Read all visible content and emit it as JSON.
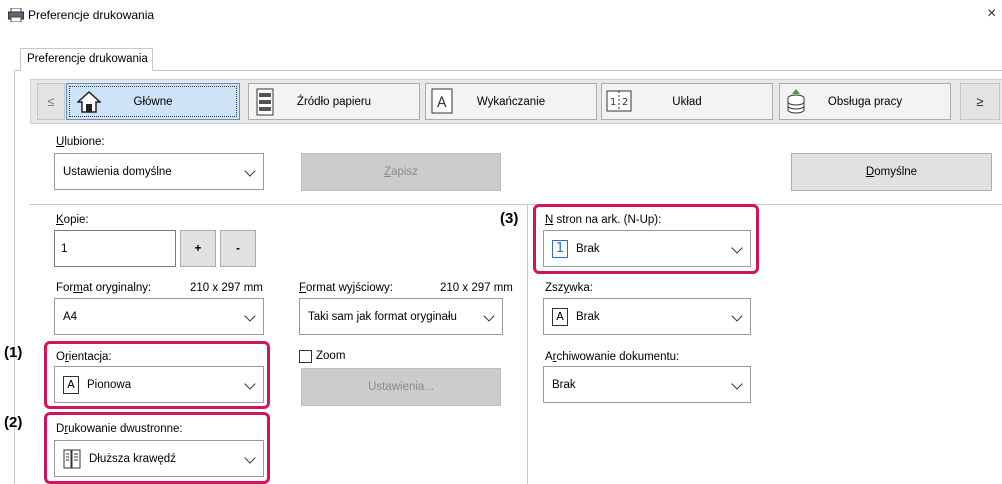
{
  "window": {
    "title": "Preferencje drukowania",
    "close_glyph": "×"
  },
  "tab": {
    "label": "Preferencje drukowania"
  },
  "toolbar": {
    "prev": "≤",
    "next": "≥",
    "buttons": [
      {
        "label": "Główne",
        "icon": "home-icon",
        "active": true
      },
      {
        "label": "Źródło papieru",
        "icon": "printer-tray-icon"
      },
      {
        "label": "Wykańczanie",
        "icon": "document-A-icon"
      },
      {
        "label": "Układ",
        "icon": "two-page-layout-icon"
      },
      {
        "label": "Obsługa pracy",
        "icon": "stack-icon"
      }
    ]
  },
  "favorites": {
    "label": "Ulubione:",
    "value": "Ustawienia domyślne",
    "save": "Zapisz",
    "defaults": "Domyślne"
  },
  "copies": {
    "label": "Kopie:",
    "value": "1",
    "plus": "+",
    "minus": "-"
  },
  "original_size": {
    "label": "Format oryginalny:",
    "dims": "210 x 297 mm",
    "value": "A4"
  },
  "output_size": {
    "label": "Format wyjściowy:",
    "dims": "210 x 297 mm",
    "value": "Taki sam jak format oryginału"
  },
  "orientation": {
    "label": "Orientacja:",
    "value": "Pionowa",
    "icon_letter": "A"
  },
  "zoom": {
    "label": "Zoom",
    "settings": "Ustawienia..."
  },
  "duplex": {
    "label": "Drukowanie dwustronne:",
    "value": "Dłuższa krawędź"
  },
  "nup": {
    "label": "N stron na ark. (N-Up):",
    "value": "Brak",
    "icon_num": "1"
  },
  "staple": {
    "label": "Zszywka:",
    "value": "Brak",
    "icon_letter": "A"
  },
  "archive": {
    "label": "Archiwowanie dokumentu:",
    "value": "Brak"
  },
  "callouts": {
    "one": "(1)",
    "two": "(2)",
    "three": "(3)"
  },
  "colors": {
    "highlight": "#d4145a",
    "active_tab": "#cfe3f7"
  }
}
